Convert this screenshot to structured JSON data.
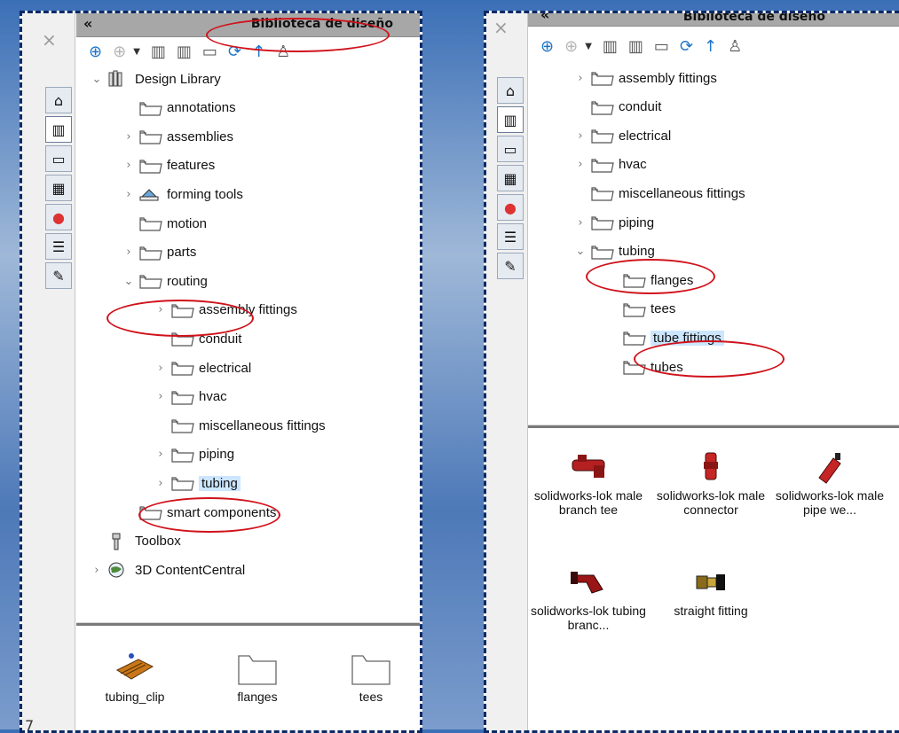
{
  "left": {
    "title": "Biblioteca de diseño",
    "tree": [
      {
        "label": "Design Library",
        "icon": "design-library-icon",
        "expand": "expanded"
      },
      {
        "label": "annotations",
        "icon": "folder-icon",
        "expand": "none"
      },
      {
        "label": "assemblies",
        "icon": "folder-icon",
        "expand": "collapsed"
      },
      {
        "label": "features",
        "icon": "folder-icon",
        "expand": "collapsed"
      },
      {
        "label": "forming tools",
        "icon": "forming-tools-icon",
        "expand": "collapsed"
      },
      {
        "label": "motion",
        "icon": "folder-icon",
        "expand": "none"
      },
      {
        "label": "parts",
        "icon": "folder-icon",
        "expand": "collapsed"
      },
      {
        "label": "routing",
        "icon": "folder-icon",
        "expand": "expanded"
      },
      {
        "label": "assembly fittings",
        "icon": "folder-icon",
        "expand": "collapsed"
      },
      {
        "label": "conduit",
        "icon": "folder-icon",
        "expand": "none"
      },
      {
        "label": "electrical",
        "icon": "folder-icon",
        "expand": "collapsed"
      },
      {
        "label": "hvac",
        "icon": "folder-icon",
        "expand": "collapsed"
      },
      {
        "label": "miscellaneous fittings",
        "icon": "folder-icon",
        "expand": "none"
      },
      {
        "label": "piping",
        "icon": "folder-icon",
        "expand": "collapsed"
      },
      {
        "label": "tubing",
        "icon": "folder-icon",
        "expand": "collapsed",
        "selected": true
      },
      {
        "label": "smart components",
        "icon": "folder-icon",
        "expand": "none"
      },
      {
        "label": "Toolbox",
        "icon": "toolbox-icon",
        "expand": "none"
      },
      {
        "label": "3D ContentCentral",
        "icon": "globe-icon",
        "expand": "collapsed"
      }
    ],
    "items": [
      {
        "label": "tubing_clip",
        "icon": "tubing-clip-icon"
      },
      {
        "label": "flanges",
        "icon": "folder-icon"
      },
      {
        "label": "tees",
        "icon": "folder-icon"
      }
    ]
  },
  "right": {
    "title": "Biblioteca de diseño",
    "tree": [
      {
        "label": "assembly fittings",
        "icon": "folder-icon",
        "expand": "collapsed"
      },
      {
        "label": "conduit",
        "icon": "folder-icon",
        "expand": "none"
      },
      {
        "label": "electrical",
        "icon": "folder-icon",
        "expand": "collapsed"
      },
      {
        "label": "hvac",
        "icon": "folder-icon",
        "expand": "collapsed"
      },
      {
        "label": "miscellaneous fittings",
        "icon": "folder-icon",
        "expand": "none"
      },
      {
        "label": "piping",
        "icon": "folder-icon",
        "expand": "collapsed"
      },
      {
        "label": "tubing",
        "icon": "folder-icon",
        "expand": "expanded"
      },
      {
        "label": "flanges",
        "icon": "folder-icon",
        "expand": "none"
      },
      {
        "label": "tees",
        "icon": "folder-icon",
        "expand": "none"
      },
      {
        "label": "tube fittings",
        "icon": "folder-icon",
        "expand": "none",
        "selected": true
      },
      {
        "label": "tubes",
        "icon": "folder-icon",
        "expand": "none"
      }
    ],
    "items": [
      {
        "label": "solidworks-lok male branch tee",
        "icon": "branch-tee-icon"
      },
      {
        "label": "solidworks-lok male connector",
        "icon": "male-connector-icon"
      },
      {
        "label": "solidworks-lok male pipe we...",
        "icon": "pipe-weld-icon"
      },
      {
        "label": "solidworks-lok tubing branc...",
        "icon": "tubing-branch-icon"
      },
      {
        "label": "straight fitting",
        "icon": "straight-fitting-icon"
      }
    ]
  },
  "toolbar": [
    "back-icon",
    "forward-icon",
    "dropdown-icon",
    "add-file-location-icon",
    "create-new-folder-icon",
    "add-to-library-icon",
    "new-folder-icon",
    "refresh-icon",
    "up-icon",
    "toolbox-icon"
  ],
  "vertical_tabs": [
    "home-icon",
    "design-library-icon",
    "file-explorer-icon",
    "view-palette-icon",
    "appearances-icon",
    "custom-properties-icon",
    "forum-icon"
  ],
  "colors": {
    "annotation_ellipse": "#d0121b",
    "frame_dashed": "#0c2a66",
    "selection": "#cce6ff",
    "title_bar": "#a7a7a7"
  }
}
